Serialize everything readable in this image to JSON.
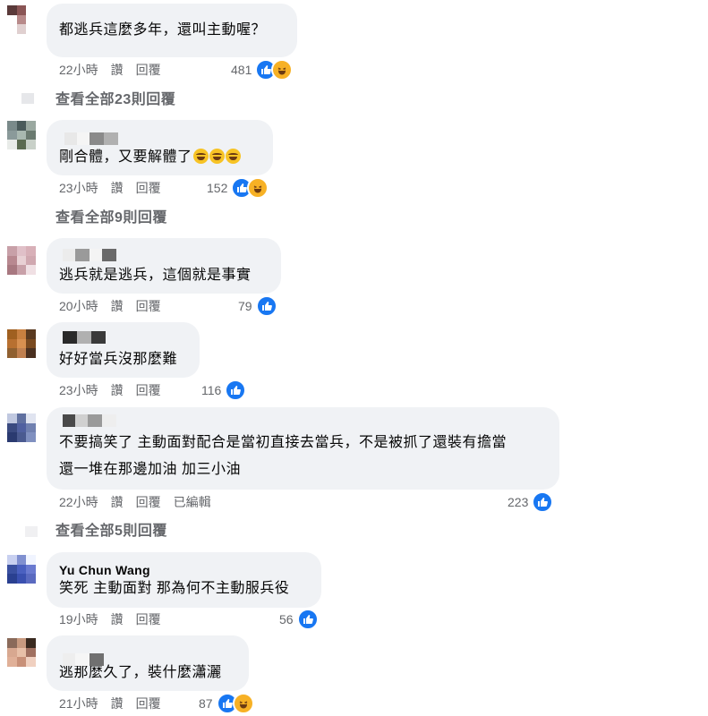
{
  "actions": {
    "like": "讚",
    "reply": "回覆"
  },
  "comments": [
    {
      "text": "都逃兵這麼多年，還叫主動喔？",
      "time": "22小時",
      "reactions": "481",
      "reaction_types": [
        "like-icon",
        "haha-icon"
      ],
      "view_replies": "查看全部23則回覆"
    },
    {
      "text": "剛合體，又要解體了",
      "emoji_suffix": [
        "laughing-face-emoji",
        "laughing-face-emoji",
        "laughing-face-emoji"
      ],
      "time": "23小時",
      "reactions": "152",
      "reaction_types": [
        "like-icon",
        "haha-icon"
      ],
      "view_replies": "查看全部9則回覆"
    },
    {
      "text": "逃兵就是逃兵，這個就是事實",
      "time": "20小時",
      "reactions": "79",
      "reaction_types": [
        "like-icon"
      ]
    },
    {
      "text": "好好當兵沒那麼難",
      "time": "23小時",
      "reactions": "116",
      "reaction_types": [
        "like-icon"
      ]
    },
    {
      "text_line1": "不要搞笑了 主動面對配合是當初直接去當兵，不是被抓了還裝有擔當",
      "text_line2": "還一堆在那邊加油 加三小油",
      "time": "22小時",
      "edited": "已編輯",
      "reactions": "223",
      "reaction_types": [
        "like-icon"
      ],
      "view_replies": "查看全部5則回覆"
    },
    {
      "author": "Yu Chun Wang",
      "text": "笑死 主動面對 那為何不主動服兵役",
      "time": "19小時",
      "reactions": "56",
      "reaction_types": [
        "like-icon"
      ]
    },
    {
      "text": "逃那麼久了，裝什麼瀟灑",
      "time": "21小時",
      "reactions": "87",
      "reaction_types": [
        "like-icon",
        "haha-icon"
      ]
    }
  ],
  "colors": {
    "bubble": "#f0f2f5",
    "like": "#1877f2",
    "haha": "#f7b125",
    "meta": "#65676b"
  }
}
